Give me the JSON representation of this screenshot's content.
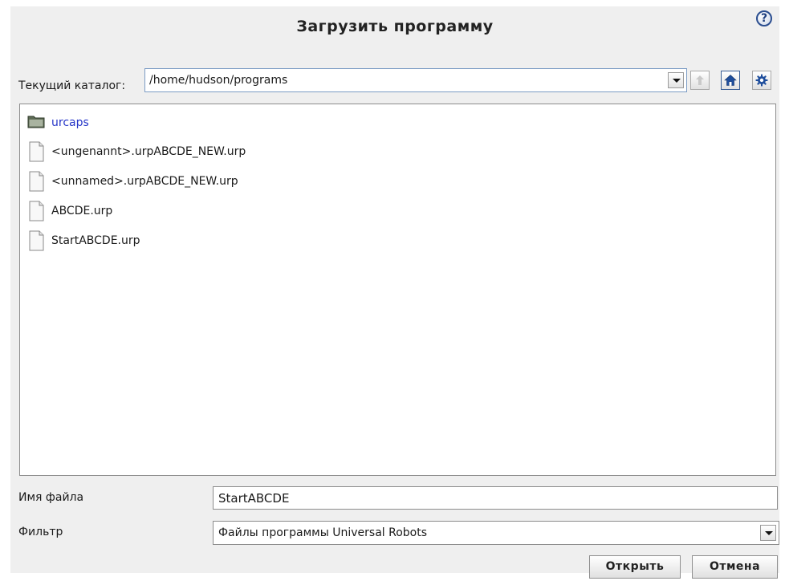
{
  "dialog": {
    "title": "Загрузить программу",
    "help_icon": "help-icon"
  },
  "directory": {
    "label": "Текущий каталог:",
    "path": "/home/hudson/programs",
    "buttons": [
      "up-icon",
      "home-icon",
      "settings-icon"
    ]
  },
  "files": [
    {
      "name": "urcaps",
      "type": "folder"
    },
    {
      "name": "<ungenannt>.urpABCDE_NEW.urp",
      "type": "file"
    },
    {
      "name": "<unnamed>.urpABCDE_NEW.urp",
      "type": "file"
    },
    {
      "name": "ABCDE.urp",
      "type": "file"
    },
    {
      "name": "StartABCDE.urp",
      "type": "file"
    }
  ],
  "form": {
    "filename_label": "Имя файла",
    "filename_value": "StartABCDE",
    "filter_label": "Фильтр",
    "filter_value": "Файлы программы Universal Robots"
  },
  "buttons": {
    "open": "Открыть",
    "cancel": "Отмена"
  },
  "colors": {
    "folder_text": "#2535c8",
    "accent_border": "#7b9bc4",
    "background": "#efefef"
  }
}
